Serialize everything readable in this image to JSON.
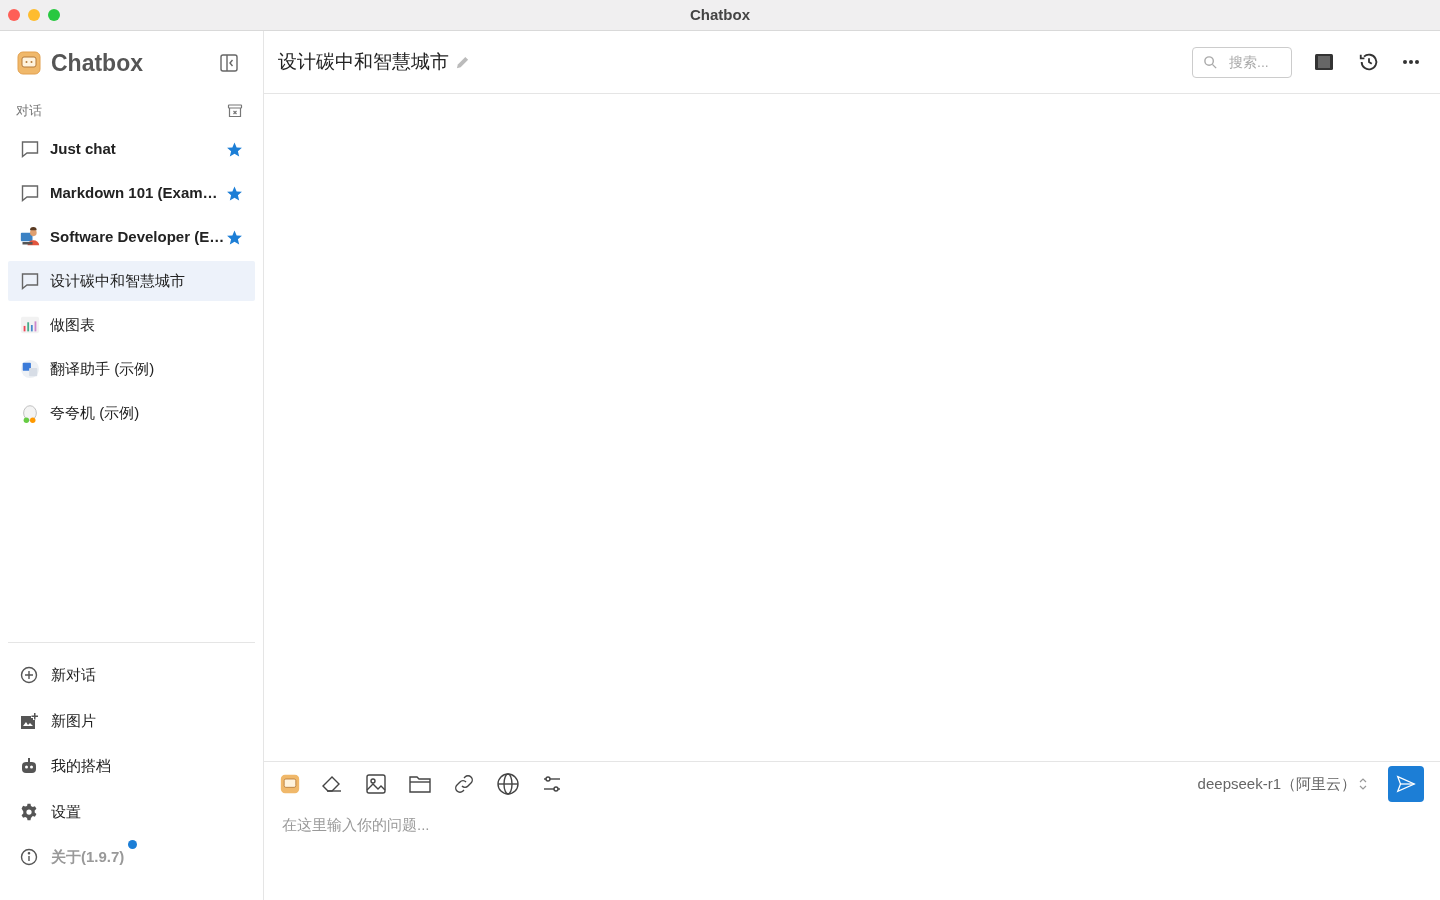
{
  "window": {
    "title": "Chatbox"
  },
  "sidebar": {
    "app_name": "Chatbox",
    "section_label": "对话",
    "conversations": [
      {
        "title": "Just chat",
        "kind": "chat",
        "starred": true,
        "selected": false
      },
      {
        "title": "Markdown 101 (Exam…",
        "kind": "chat",
        "starred": true,
        "selected": false
      },
      {
        "title": "Software Developer (E…",
        "kind": "developer",
        "starred": true,
        "selected": false
      },
      {
        "title": "设计碳中和智慧城市",
        "kind": "chat",
        "starred": false,
        "selected": true
      },
      {
        "title": "做图表",
        "kind": "chart",
        "starred": false,
        "selected": false
      },
      {
        "title": "翻译助手 (示例)",
        "kind": "translate",
        "starred": false,
        "selected": false
      },
      {
        "title": "夸夸机 (示例)",
        "kind": "mascot",
        "starred": false,
        "selected": false
      }
    ],
    "menu": [
      {
        "label": "新对话",
        "kind": "plus",
        "muted": false,
        "badge": false
      },
      {
        "label": "新图片",
        "kind": "image",
        "muted": false,
        "badge": false
      },
      {
        "label": "我的搭档",
        "kind": "robot",
        "muted": false,
        "badge": false
      },
      {
        "label": "设置",
        "kind": "gear",
        "muted": false,
        "badge": false
      },
      {
        "label": "关于(1.9.7)",
        "kind": "info",
        "muted": true,
        "badge": true
      }
    ]
  },
  "header": {
    "title": "设计碳中和智慧城市",
    "search": {
      "placeholder": "搜索..."
    }
  },
  "composer": {
    "placeholder": "在这里输入你的问题...",
    "model": "deepseek-r1（阿里云）"
  }
}
